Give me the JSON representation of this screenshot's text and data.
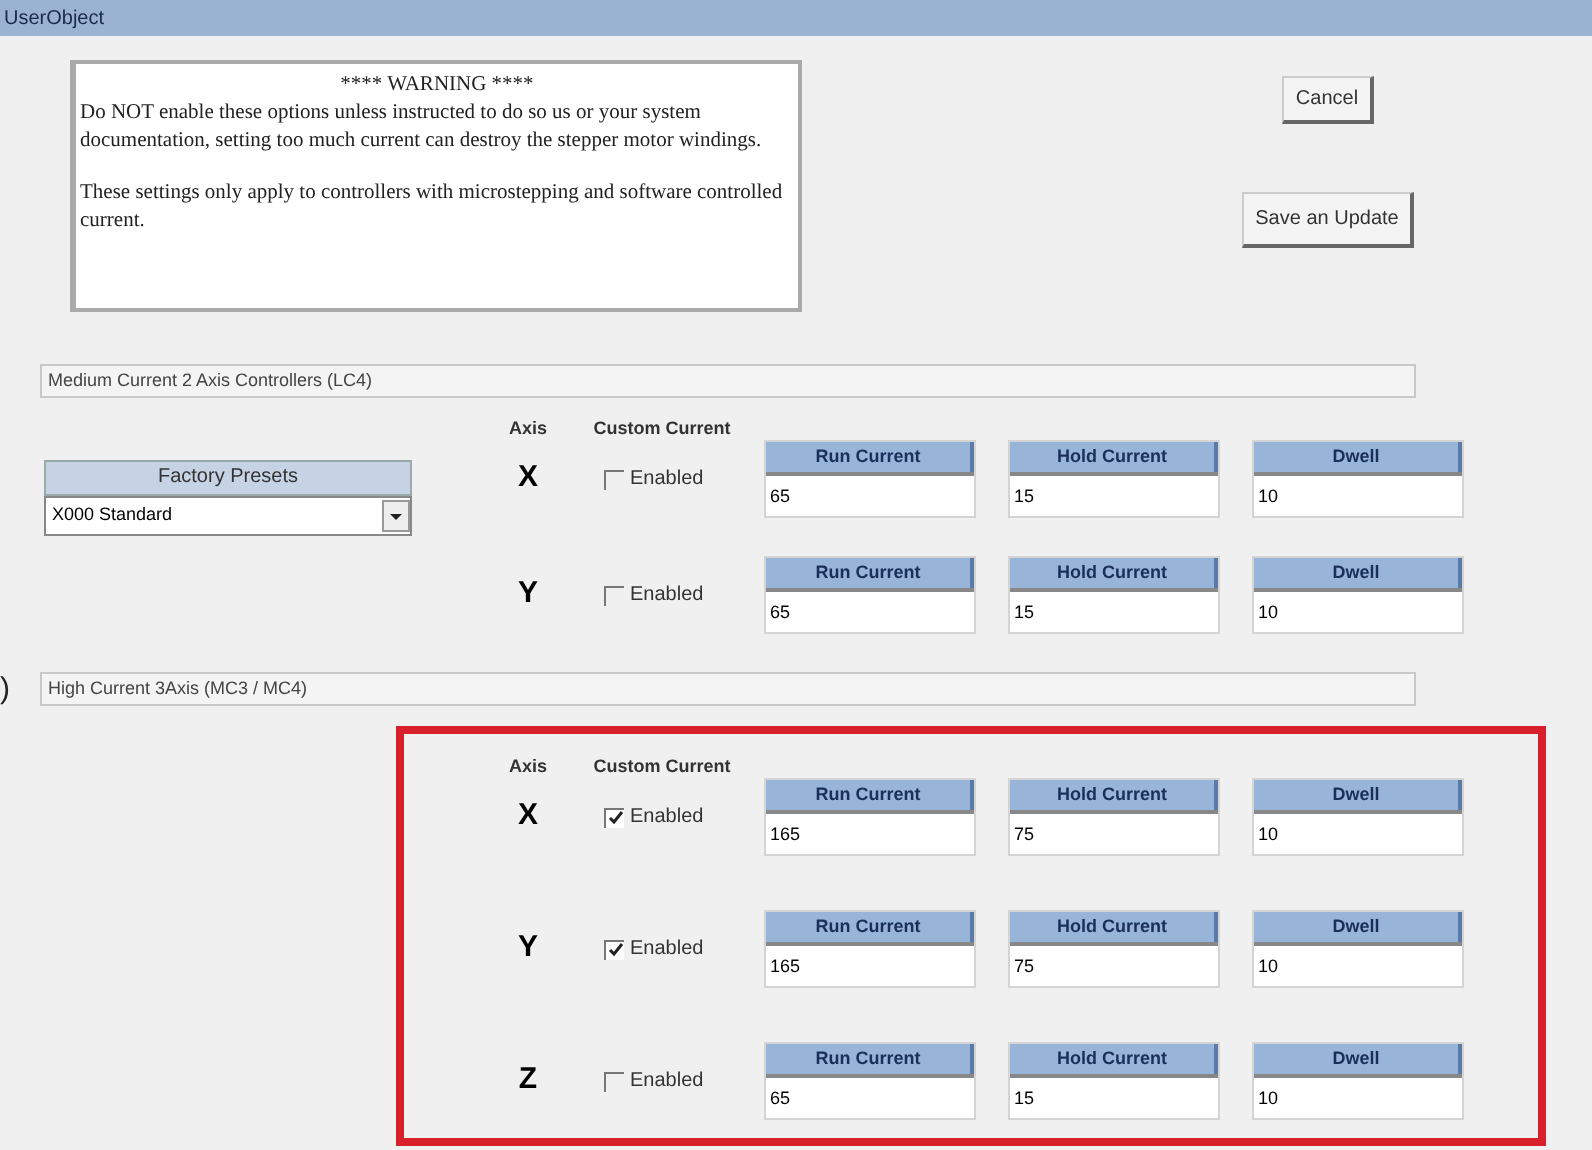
{
  "window": {
    "title": "UserObject"
  },
  "warning": {
    "heading": "**** WARNING ****",
    "paragraphs": [
      "Do NOT enable these options unless instructed to do so us or your system documentation, setting too much current can destroy the stepper motor windings.",
      "These settings only apply to controllers with microstepping and software controlled current."
    ]
  },
  "buttons": [
    {
      "label": "Cancel"
    },
    {
      "label": "Save an Update"
    }
  ],
  "edge_text": ")",
  "sections": [
    {
      "title": "Medium Current 2 Axis Controllers (LC4)",
      "highlighted": false,
      "presets": {
        "label": "Factory Presets",
        "value": "X000 Standard"
      },
      "axis_header": "Axis",
      "custom_header": "Custom Current",
      "axes": [
        {
          "axis": "X",
          "checkbox_label": "Enabled",
          "checked": false,
          "fields": [
            {
              "label": "Run Current",
              "value": "65"
            },
            {
              "label": "Hold Current",
              "value": "15"
            },
            {
              "label": "Dwell",
              "value": "10"
            }
          ]
        },
        {
          "axis": "Y",
          "checkbox_label": "Enabled",
          "checked": false,
          "fields": [
            {
              "label": "Run Current",
              "value": "65"
            },
            {
              "label": "Hold Current",
              "value": "15"
            },
            {
              "label": "Dwell",
              "value": "10"
            }
          ]
        }
      ]
    },
    {
      "title": "High Current 3Axis (MC3 / MC4)",
      "highlighted": true,
      "axis_header": "Axis",
      "custom_header": "Custom Current",
      "axes": [
        {
          "axis": "X",
          "checkbox_label": "Enabled",
          "checked": true,
          "fields": [
            {
              "label": "Run Current",
              "value": "165"
            },
            {
              "label": "Hold Current",
              "value": "75"
            },
            {
              "label": "Dwell",
              "value": "10"
            }
          ]
        },
        {
          "axis": "Y",
          "checkbox_label": "Enabled",
          "checked": true,
          "fields": [
            {
              "label": "Run Current",
              "value": "165"
            },
            {
              "label": "Hold Current",
              "value": "75"
            },
            {
              "label": "Dwell",
              "value": "10"
            }
          ]
        },
        {
          "axis": "Z",
          "checkbox_label": "Enabled",
          "checked": false,
          "fields": [
            {
              "label": "Run Current",
              "value": "65"
            },
            {
              "label": "Hold Current",
              "value": "15"
            },
            {
              "label": "Dwell",
              "value": "10"
            }
          ]
        }
      ]
    }
  ]
}
